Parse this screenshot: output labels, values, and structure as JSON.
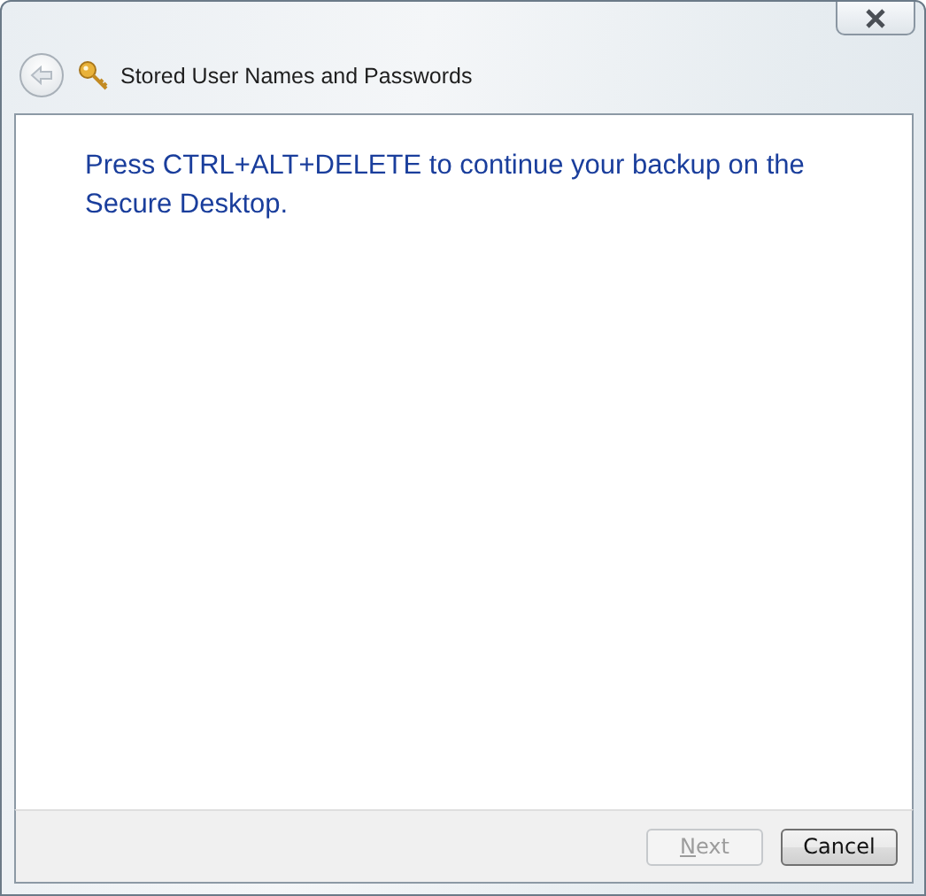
{
  "window": {
    "title": "Stored User Names and Passwords"
  },
  "message": "Press CTRL+ALT+DELETE to continue your backup on the Secure Desktop.",
  "buttons": [
    {
      "label": "Next",
      "disabled": true,
      "access_key_underlined": true
    },
    {
      "label": "Cancel",
      "disabled": false
    }
  ]
}
